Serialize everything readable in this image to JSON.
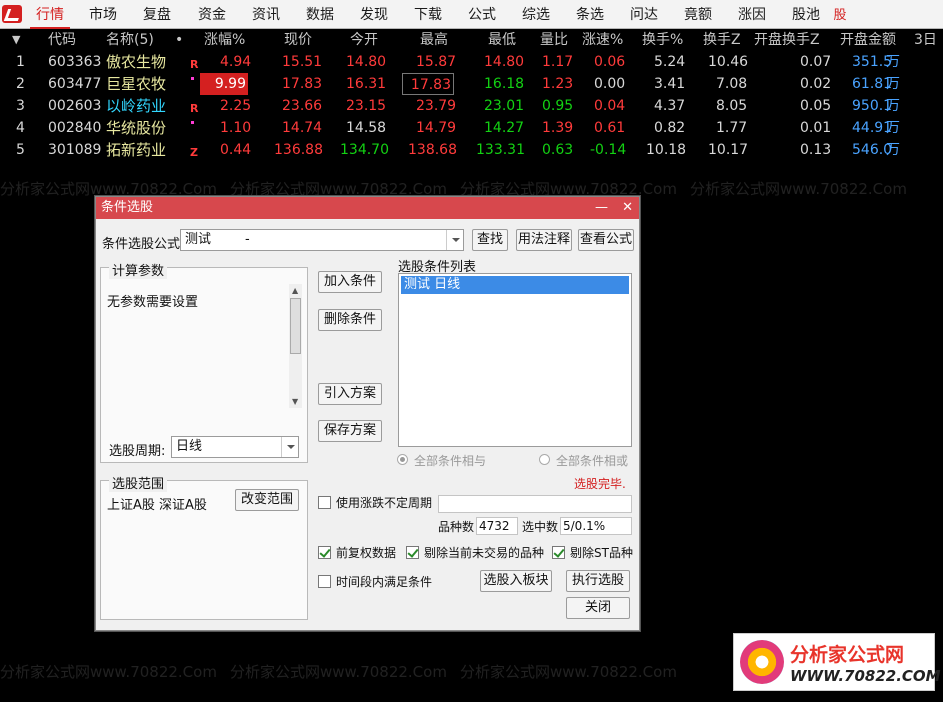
{
  "menu": {
    "items": [
      "行情",
      "市场",
      "复盘",
      "资金",
      "资讯",
      "数据",
      "发现",
      "下载",
      "公式",
      "综选",
      "条选",
      "问达",
      "竟额",
      "涨因",
      "股池"
    ],
    "stock_label": "股"
  },
  "table": {
    "sort_marker": "▼",
    "headers": {
      "code": "代码",
      "name": "名称(5)",
      "dot": "•",
      "change_pct": "涨幅%",
      "price": "现价",
      "open": "今开",
      "high": "最高",
      "low": "最低",
      "vol_ratio": "量比",
      "speed": "涨速%",
      "turnover": "换手%",
      "turnover_z": "换手Z",
      "open_turnover_z": "开盘换手Z",
      "open_amount": "开盘金额",
      "d3": "3日"
    },
    "rows": [
      {
        "idx": "1",
        "code": "603363",
        "name": "傲农生物",
        "tag": "R",
        "change_pct": "4.94",
        "price": "15.51",
        "open": "14.80",
        "high": "15.87",
        "low": "14.80",
        "vol_ratio": "1.17",
        "speed": "0.06",
        "turnover": "5.24",
        "turnover_z": "10.46",
        "open_turnover_z": "0.07",
        "open_amount": "351.5",
        "unit": "万"
      },
      {
        "idx": "2",
        "code": "603477",
        "name": "巨星农牧",
        "tag": "",
        "change_pct": "9.99",
        "price": "17.83",
        "open": "16.31",
        "high": "17.83",
        "low": "16.18",
        "vol_ratio": "1.23",
        "speed": "0.00",
        "turnover": "3.41",
        "turnover_z": "7.08",
        "open_turnover_z": "0.02",
        "open_amount": "61.81",
        "unit": "万"
      },
      {
        "idx": "3",
        "code": "002603",
        "name": "以岭药业",
        "tag": "R",
        "change_pct": "2.25",
        "price": "23.66",
        "open": "23.15",
        "high": "23.79",
        "low": "23.01",
        "vol_ratio": "0.95",
        "speed": "0.04",
        "turnover": "4.37",
        "turnover_z": "8.05",
        "open_turnover_z": "0.05",
        "open_amount": "950.1",
        "unit": "万"
      },
      {
        "idx": "4",
        "code": "002840",
        "name": "华统股份",
        "tag": "",
        "change_pct": "1.10",
        "price": "14.74",
        "open": "14.58",
        "high": "14.79",
        "low": "14.27",
        "vol_ratio": "1.39",
        "speed": "0.61",
        "turnover": "0.82",
        "turnover_z": "1.77",
        "open_turnover_z": "0.01",
        "open_amount": "44.91",
        "unit": "万"
      },
      {
        "idx": "5",
        "code": "301089",
        "name": "拓新药业",
        "tag": "Z",
        "change_pct": "0.44",
        "price": "136.88",
        "open": "134.70",
        "high": "138.68",
        "low": "133.31",
        "vol_ratio": "0.63",
        "speed": "-0.14",
        "turnover": "10.18",
        "turnover_z": "10.17",
        "open_turnover_z": "0.13",
        "open_amount": "546.0",
        "unit": "万"
      }
    ]
  },
  "watermark": "分析家公式网www.70822.Com",
  "dialog": {
    "title": "条件选股",
    "minimize": "—",
    "close": "✕",
    "formula_label": "条件选股公式",
    "formula_value": "测试",
    "formula_dash": "-",
    "btn_find": "查找",
    "btn_usage": "用法注释",
    "btn_view": "查看公式",
    "params_title": "计算参数",
    "params_text": "无参数需要设置",
    "period_label": "选股周期:",
    "period_value": "日线",
    "range_title": "选股范围",
    "range_text": "上证A股 深证A股",
    "btn_change_range": "改变范围",
    "btn_add": "加入条件",
    "btn_delete": "删除条件",
    "btn_import": "引入方案",
    "btn_save": "保存方案",
    "list_title": "选股条件列表",
    "list_items": [
      "测试  日线"
    ],
    "radio_and": "全部条件相与",
    "radio_or": "全部条件相或",
    "status": "选股完毕.",
    "status_color": "#d42020",
    "chk_uncertain": "使用涨跌不定周期",
    "count_label": "品种数",
    "count_value": "4732",
    "selected_label": "选中数",
    "selected_value": "5/0.1%",
    "chk_adjust": "前复权数据",
    "chk_exclude_untraded": "剔除当前未交易的品种",
    "chk_exclude_st": "剔除ST品种",
    "chk_period": "时间段内满足条件",
    "btn_to_block": "选股入板块",
    "btn_run": "执行选股",
    "btn_close": "关闭"
  },
  "logo": {
    "title": "分析家公式网",
    "url": "WWW.70822.COM"
  },
  "colors": {
    "up": "#ff3b3b",
    "down": "#13d113",
    "accent": "#d42020",
    "dialog_title": "#d7484d",
    "selection": "#3c8be6"
  }
}
